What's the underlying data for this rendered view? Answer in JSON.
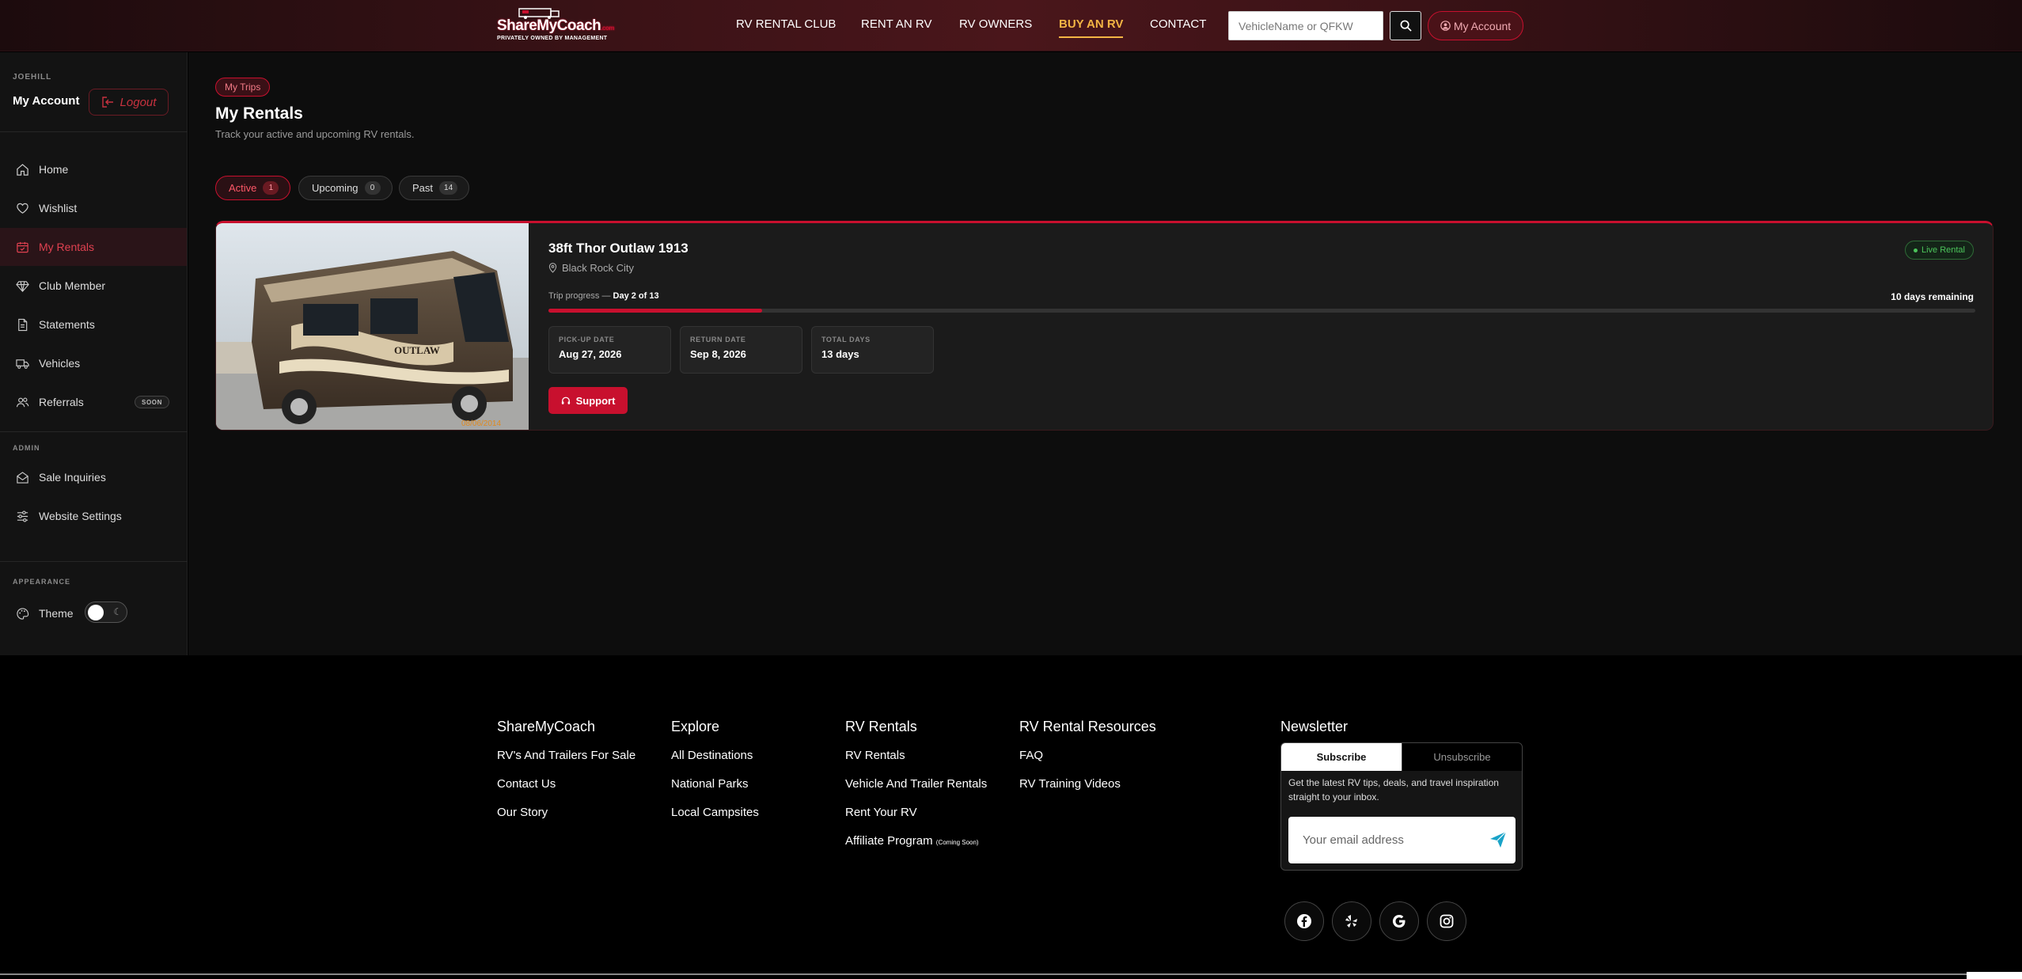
{
  "header": {
    "logo_text": "ShareMyCoach",
    "logo_suffix": ".com",
    "logo_tagline": "PRIVATELY OWNED BY MANAGEMENT",
    "nav": [
      {
        "label": "RV RENTAL CLUB"
      },
      {
        "label": "RENT AN RV"
      },
      {
        "label": "RV OWNERS"
      },
      {
        "label": "BUY AN RV"
      },
      {
        "label": "CONTACT"
      }
    ],
    "active_nav": "BUY AN RV",
    "search_placeholder": "VehicleName or QFKW",
    "account_label": "My Account",
    "accent_color": "#f3b544"
  },
  "sidebar": {
    "username": "JOEHILL",
    "account_title": "My Account",
    "logout_label": "Logout",
    "items": [
      {
        "label": "Home",
        "icon": "home-icon"
      },
      {
        "label": "Wishlist",
        "icon": "heart-icon"
      },
      {
        "label": "My Rentals",
        "icon": "calendar-icon",
        "active": true
      },
      {
        "label": "Club Member",
        "icon": "diamond-icon"
      },
      {
        "label": "Statements",
        "icon": "document-icon"
      },
      {
        "label": "Vehicles",
        "icon": "truck-icon"
      },
      {
        "label": "Referrals",
        "icon": "users-icon",
        "badge": "SOON"
      }
    ],
    "admin_heading": "ADMIN",
    "admin_items": [
      {
        "label": "Sale Inquiries",
        "icon": "envelope-open-icon"
      },
      {
        "label": "Website Settings",
        "icon": "sliders-icon"
      }
    ],
    "appearance_heading": "APPEARANCE",
    "theme_label": "Theme"
  },
  "main": {
    "section_pill": "My Trips",
    "title": "My Rentals",
    "subtitle": "Track your active and upcoming RV rentals.",
    "tabs": [
      {
        "label": "Active",
        "count": "1",
        "active": true
      },
      {
        "label": "Upcoming",
        "count": "0"
      },
      {
        "label": "Past",
        "count": "14"
      }
    ],
    "rental": {
      "name": "38ft Thor Outlaw 1913",
      "location": "Black Rock City",
      "status": "Live Rental",
      "progress_prefix": "Trip progress —",
      "progress_day": "Day 2 of 13",
      "progress_fraction": 0.15,
      "remaining": "10 days remaining",
      "photo_stamp": "08/06/2014",
      "photo_decal": "OUTLAW",
      "dates": [
        {
          "label": "PICK-UP DATE",
          "value": "Aug 27, 2026"
        },
        {
          "label": "RETURN DATE",
          "value": "Sep 8, 2026"
        },
        {
          "label": "TOTAL DAYS",
          "value": "13 days"
        }
      ],
      "support_label": "Support"
    },
    "brand_color": "#c8102e",
    "live_color": "#4cc45b"
  },
  "footer": {
    "columns": [
      {
        "heading": "ShareMyCoach",
        "links": [
          "RV's And Trailers For Sale",
          "Contact Us",
          "Our Story"
        ]
      },
      {
        "heading": "Explore",
        "links": [
          "All Destinations",
          "National Parks",
          "Local Campsites"
        ]
      },
      {
        "heading": "RV Rentals",
        "links": [
          "RV Rentals",
          "Vehicle And Trailer Rentals",
          "Rent Your RV",
          "Affiliate Program"
        ]
      },
      {
        "heading": "RV Rental Resources",
        "links": [
          "FAQ",
          "RV Training Videos"
        ]
      }
    ],
    "affiliate_note": "(Coming Soon)",
    "newsletter": {
      "heading": "Newsletter",
      "tab_subscribe": "Subscribe",
      "tab_unsubscribe": "Unsubscribe",
      "description": "Get the latest RV tips, deals, and travel inspiration straight to your inbox.",
      "email_placeholder": "Your email address"
    },
    "social": [
      "facebook-icon",
      "yelp-icon",
      "google-icon",
      "instagram-icon"
    ]
  }
}
